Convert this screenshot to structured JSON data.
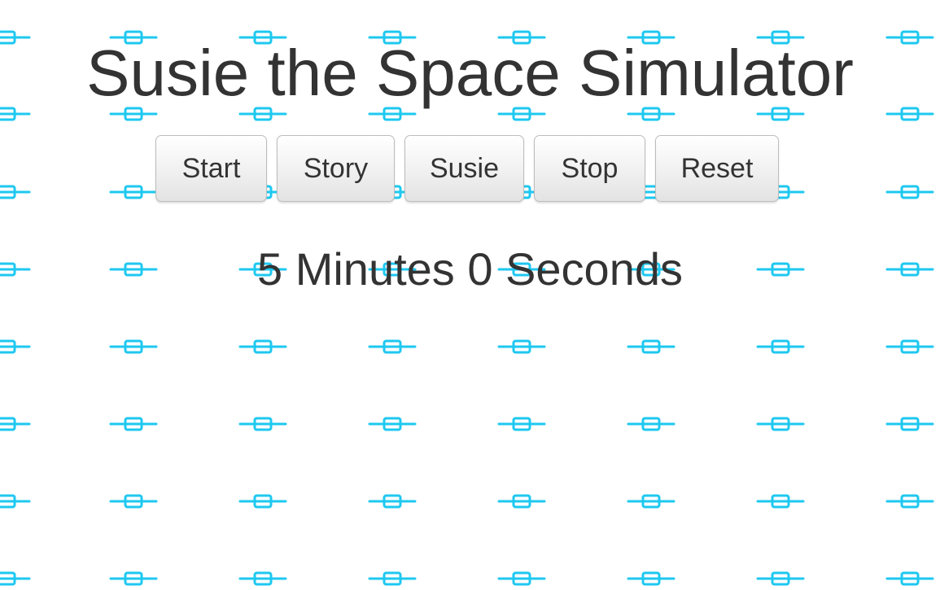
{
  "page": {
    "title": "Susie the Space Simulator"
  },
  "controls": {
    "start_label": "Start",
    "story_label": "Story",
    "susie_label": "Susie",
    "stop_label": "Stop",
    "reset_label": "Reset"
  },
  "timer": {
    "text": "5 Minutes 0 Seconds"
  },
  "background": {
    "pattern_icon": "satellite-icon",
    "pattern_color": "#1ec8f0"
  }
}
